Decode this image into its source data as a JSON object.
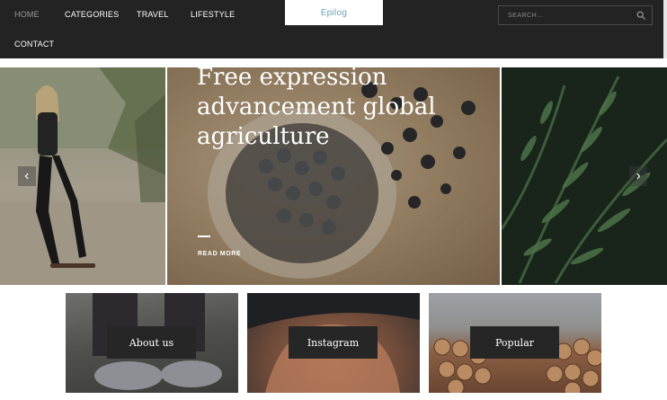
{
  "nav": {
    "items": [
      "HOME",
      "CATEGORIES",
      "TRAVEL",
      "LIFESTYLE",
      "CONTACT"
    ],
    "logo": "Epilog",
    "search_placeholder": "SEARCH..."
  },
  "hero": {
    "title": "Free expression advancement global agriculture",
    "cta": "READ MORE"
  },
  "cards": [
    {
      "label": "About us"
    },
    {
      "label": "Instagram"
    },
    {
      "label": "Popular"
    }
  ],
  "colors": {
    "header_bg": "#232323",
    "logo_text": "#6aa3b8",
    "label_bg": "#262626"
  },
  "icons": [
    "search-icon",
    "chevron-left-icon",
    "chevron-right-icon"
  ]
}
